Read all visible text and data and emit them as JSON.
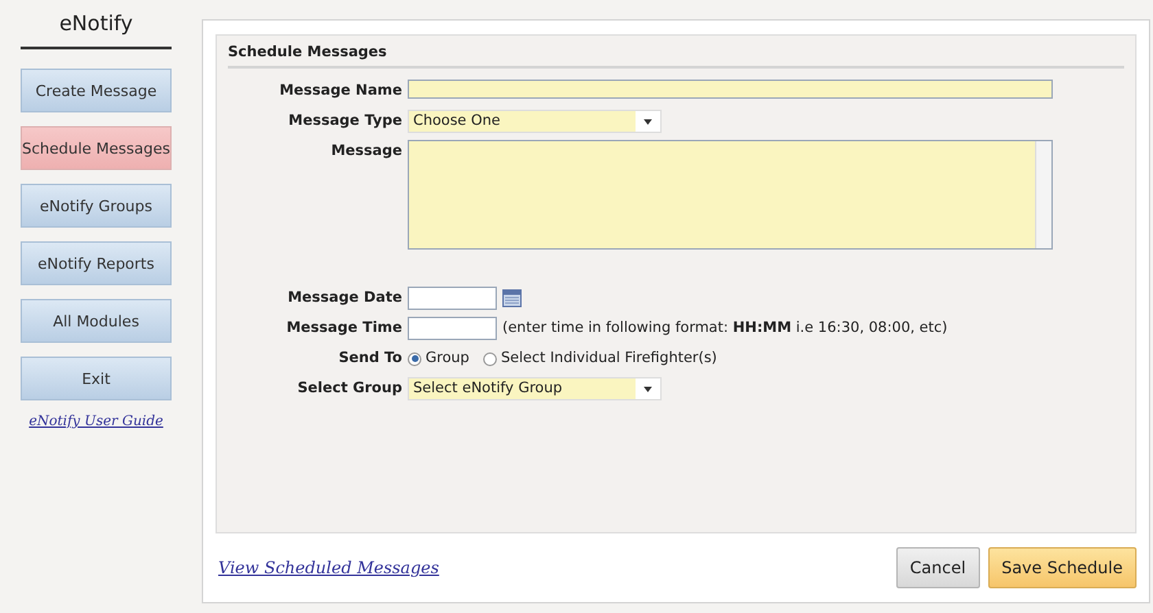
{
  "sidebar": {
    "title": "eNotify",
    "items": [
      {
        "label": "Create Message",
        "selected": false
      },
      {
        "label": "Schedule Messages",
        "selected": true
      },
      {
        "label": "eNotify Groups",
        "selected": false
      },
      {
        "label": "eNotify Reports",
        "selected": false
      },
      {
        "label": "All Modules",
        "selected": false
      },
      {
        "label": "Exit",
        "selected": false
      }
    ],
    "guide_link": "eNotify User Guide"
  },
  "panel": {
    "title": "Schedule Messages",
    "message_name": {
      "label": "Message Name"
    },
    "message_type": {
      "label": "Message Type",
      "value": "Choose One"
    },
    "message": {
      "label": "Message"
    },
    "message_date": {
      "label": "Message Date"
    },
    "message_time": {
      "label": "Message Time",
      "hint": "(enter time in following format: **HH:MM** i.e 16:30, 08:00, etc)"
    },
    "send_to": {
      "label": "Send To",
      "options": [
        {
          "label": "Group",
          "selected": true
        },
        {
          "label": "Select Individual Firefighter(s)",
          "selected": false
        }
      ]
    },
    "select_group": {
      "label": "Select Group",
      "value": "Select eNotify Group"
    }
  },
  "footer": {
    "link": "View Scheduled Messages",
    "buttons": [
      {
        "label": "Cancel",
        "kind": "secondary"
      },
      {
        "label": "Save Schedule",
        "kind": "primary"
      }
    ]
  }
}
